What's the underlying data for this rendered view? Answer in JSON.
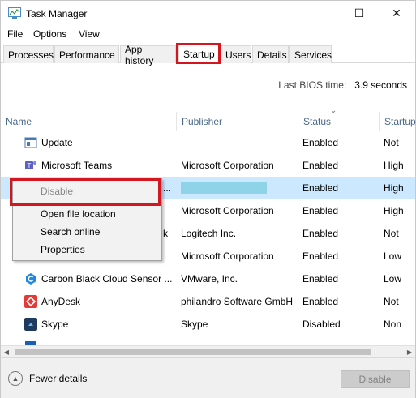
{
  "window": {
    "title": "Task Manager",
    "minimize": "—",
    "maximize": "☐",
    "close": "✕"
  },
  "menu": [
    "File",
    "Options",
    "View"
  ],
  "tabs": [
    "Processes",
    "Performance",
    "App history",
    "Startup",
    "Users",
    "Details",
    "Services"
  ],
  "active_tab": "Startup",
  "bios": {
    "label": "Last BIOS time:",
    "value": "3.9 seconds"
  },
  "columns": [
    "Name",
    "Publisher",
    "Status",
    "Startup"
  ],
  "rows": [
    {
      "name": "Update",
      "publisher": "",
      "status": "Enabled",
      "impact": "Not",
      "icon": "window-icon",
      "color": "#4a78b5"
    },
    {
      "name": "Microsoft Teams",
      "publisher": "Microsoft Corporation",
      "status": "Enabled",
      "impact": "High",
      "icon": "teams-icon",
      "color": "#5b5fc7"
    },
    {
      "name": "",
      "publisher": "",
      "status": "Enabled",
      "impact": "High",
      "icon": "app-icon",
      "color": "#2f6fb0",
      "selected": true,
      "trailing": "..."
    },
    {
      "name": "",
      "publisher": "Microsoft Corporation",
      "status": "Enabled",
      "impact": "High",
      "icon": "app-icon",
      "color": "#3a7bd5"
    },
    {
      "name": "",
      "publisher": "Logitech Inc.",
      "status": "Enabled",
      "impact": "Not",
      "icon": "app-icon",
      "color": "#444444",
      "trailing": "k"
    },
    {
      "name": "",
      "publisher": "Microsoft Corporation",
      "status": "Enabled",
      "impact": "Low",
      "icon": "app-icon",
      "color": "#3a7bd5"
    },
    {
      "name": "Carbon Black Cloud Sensor ...",
      "publisher": "VMware, Inc.",
      "status": "Enabled",
      "impact": "Low",
      "icon": "carbon-black-icon",
      "color": "#1e88e5"
    },
    {
      "name": "AnyDesk",
      "publisher": "philandro Software GmbH",
      "status": "Enabled",
      "impact": "Not",
      "icon": "anydesk-icon",
      "color": "#e53935"
    },
    {
      "name": "Skype",
      "publisher": "Skype",
      "status": "Disabled",
      "impact": "Non",
      "icon": "skype-icon",
      "color": "#2b6cb0"
    },
    {
      "name": "",
      "publisher": "",
      "status": "",
      "impact": "",
      "icon": "app-icon",
      "color": "#1a5fb4"
    }
  ],
  "context_menu": [
    "Disable",
    "Open file location",
    "Search online",
    "Properties"
  ],
  "footer": {
    "fewer_details": "Fewer details",
    "disable": "Disable"
  },
  "scroll_arrows": {
    "left": "◀",
    "right": "▶",
    "sort": "⌄"
  },
  "colors": {
    "highlight": "#d6161e",
    "selection": "#cce8ff",
    "header_text": "#4a6a8a"
  }
}
